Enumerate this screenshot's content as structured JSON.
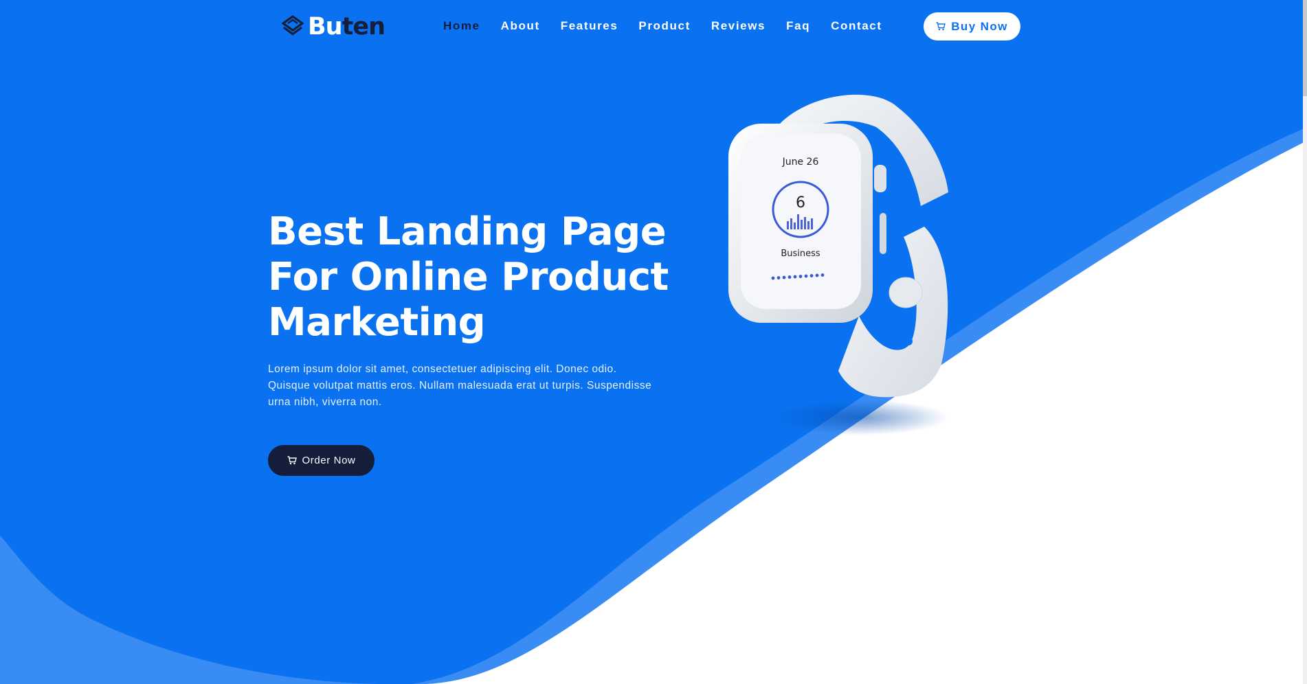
{
  "brand": {
    "part1": "Bu",
    "part2": "ten"
  },
  "nav": {
    "items": [
      {
        "label": "Home"
      },
      {
        "label": "About"
      },
      {
        "label": "Features"
      },
      {
        "label": "Product"
      },
      {
        "label": "Reviews"
      },
      {
        "label": "Faq"
      },
      {
        "label": "Contact"
      }
    ],
    "buy_label": "Buy Now"
  },
  "hero": {
    "title": "Best Landing Page For Online Product Marketing",
    "description": "Lorem ipsum dolor sit amet, consectetuer adipiscing elit. Donec odio. Quisque volutpat mattis eros. Nullam malesuada erat ut turpis. Suspendisse urna nibh, viverra non.",
    "order_label": "Order Now"
  },
  "watch": {
    "date": "June 26",
    "value": "6",
    "label": "Business"
  },
  "colors": {
    "primary": "#0a72f0",
    "dark": "#141d3a",
    "white": "#ffffff"
  },
  "icons": {
    "logo": "layers-icon",
    "cart": "cart-icon"
  }
}
